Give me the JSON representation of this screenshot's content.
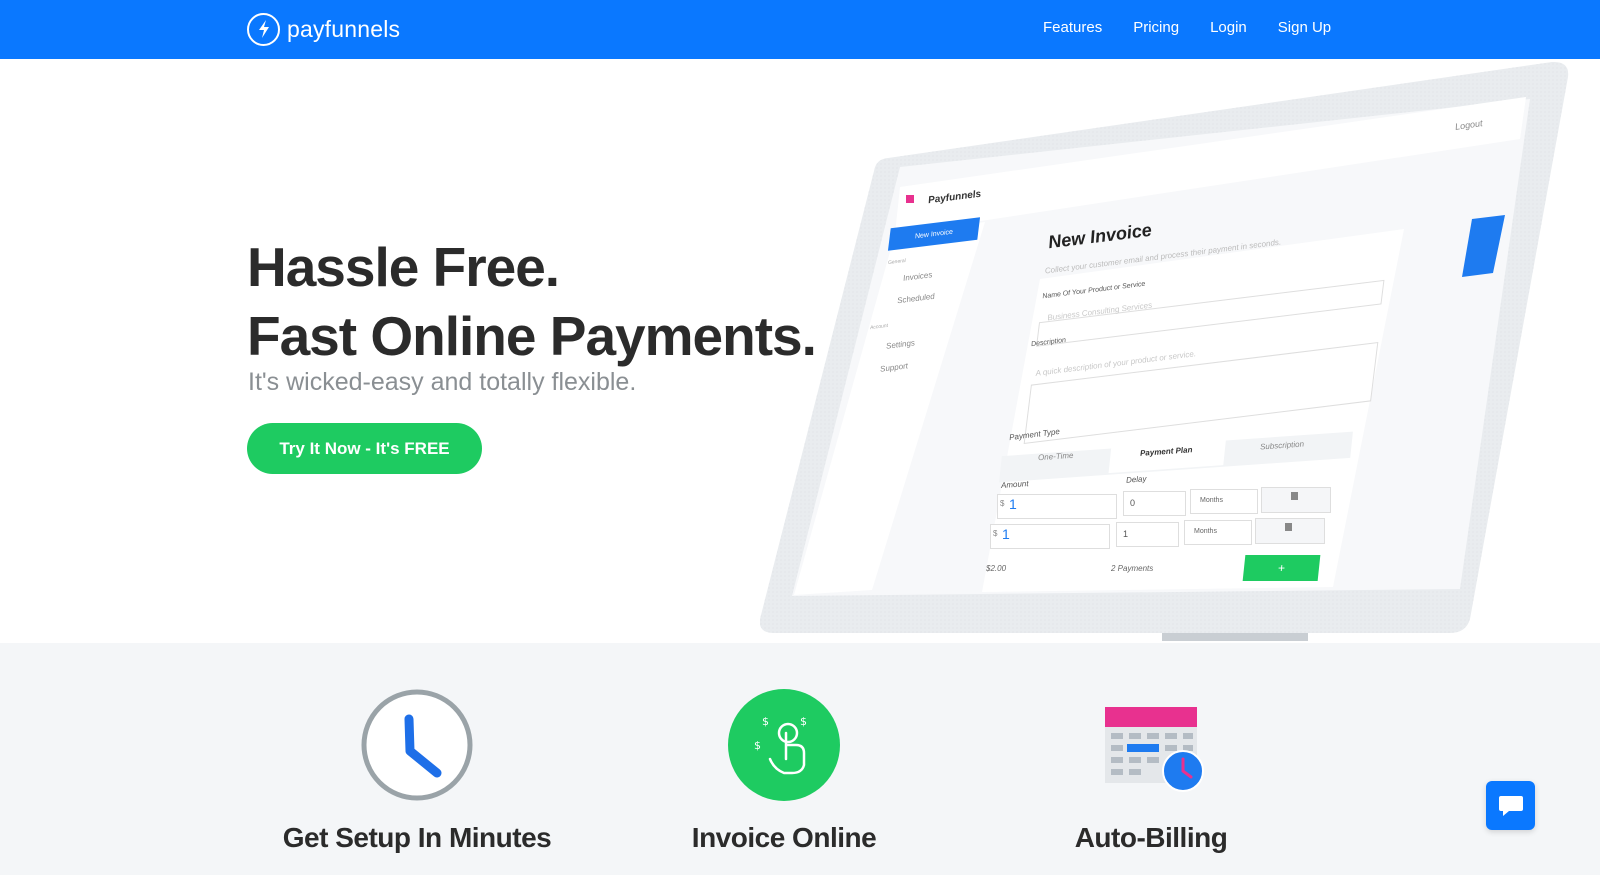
{
  "nav": {
    "logo_text": "payfunnels",
    "links": [
      "Features",
      "Pricing",
      "Login",
      "Sign Up"
    ]
  },
  "hero": {
    "headline_line1": "Hassle Free.",
    "headline_line2": "Fast Online Payments.",
    "subheadline": "It's wicked-easy and totally flexible.",
    "cta_label": "Try It Now - It's FREE"
  },
  "mockup": {
    "logout": "Logout",
    "sidebar_logo": "Payfunnels",
    "new_invoice_button": "New Invoice",
    "sidebar_section_general": "General",
    "sidebar_invoices": "Invoices",
    "sidebar_scheduled": "Scheduled",
    "sidebar_section_account": "Account",
    "sidebar_settings": "Settings",
    "sidebar_support": "Support",
    "title": "New Invoice",
    "subtitle": "Collect your customer email and process their payment in seconds.",
    "product_label": "Name Of Your Product or Service",
    "product_placeholder": "Business Consulting Services",
    "description_label": "Description",
    "description_placeholder": "A quick description of your product or service.",
    "payment_type_label": "Payment Type",
    "tabs": [
      "One-Time",
      "Payment Plan",
      "Subscription"
    ],
    "amount_label": "Amount",
    "delay_label": "Delay",
    "rows": [
      {
        "currency": "$",
        "amount": "1",
        "delay": "0",
        "unit": "Months"
      },
      {
        "currency": "$",
        "amount": "1",
        "delay": "1",
        "unit": "Months"
      }
    ],
    "total": "$2.00",
    "payments_count": "2 Payments",
    "add_button": "+"
  },
  "features": [
    {
      "title": "Get Setup In Minutes",
      "icon": "clock-icon"
    },
    {
      "title": "Invoice Online",
      "icon": "tap-payment-icon"
    },
    {
      "title": "Auto-Billing",
      "icon": "calendar-clock-icon"
    }
  ],
  "colors": {
    "brand_blue": "#0a78ff",
    "cta_green": "#1ecb61",
    "calendar_pink": "#e8318f"
  }
}
